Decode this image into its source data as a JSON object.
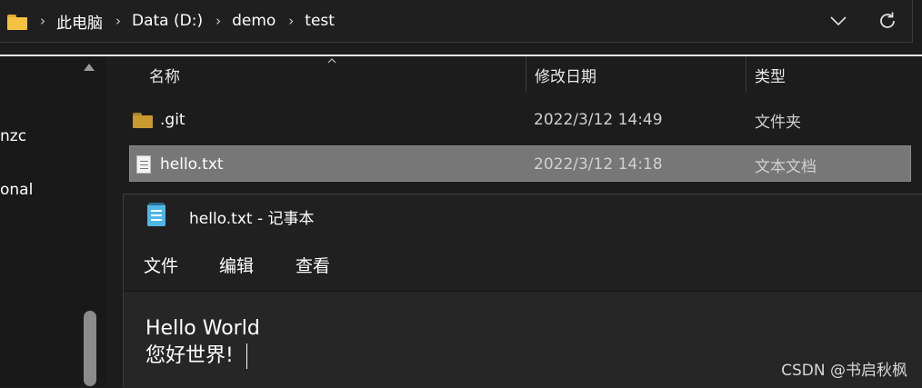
{
  "address_bar": {
    "crumbs": [
      "此电脑",
      "Data (D:)",
      "demo",
      "test"
    ],
    "sep": "›"
  },
  "nav": {
    "items": [
      "nzc",
      "onal"
    ]
  },
  "file_list": {
    "columns": [
      "名称",
      "修改日期",
      "类型"
    ],
    "rows": [
      {
        "name": ".git",
        "modified": "2022/3/12 14:49",
        "type": "文件夹",
        "icon": "folder-icon"
      },
      {
        "name": "hello.txt",
        "modified": "2022/3/12 14:18",
        "type": "文本文档",
        "icon": "text-file-icon",
        "selected": true
      }
    ]
  },
  "notepad": {
    "title": "hello.txt - 记事本",
    "menu": [
      "文件",
      "编辑",
      "查看"
    ],
    "lines": [
      "Hello World",
      "您好世界!"
    ]
  },
  "watermark": "CSDN @书启秋枫",
  "colors": {
    "folder": "#f5c242",
    "selection": "#777777",
    "notepad_icon": "#4fb7e6"
  }
}
